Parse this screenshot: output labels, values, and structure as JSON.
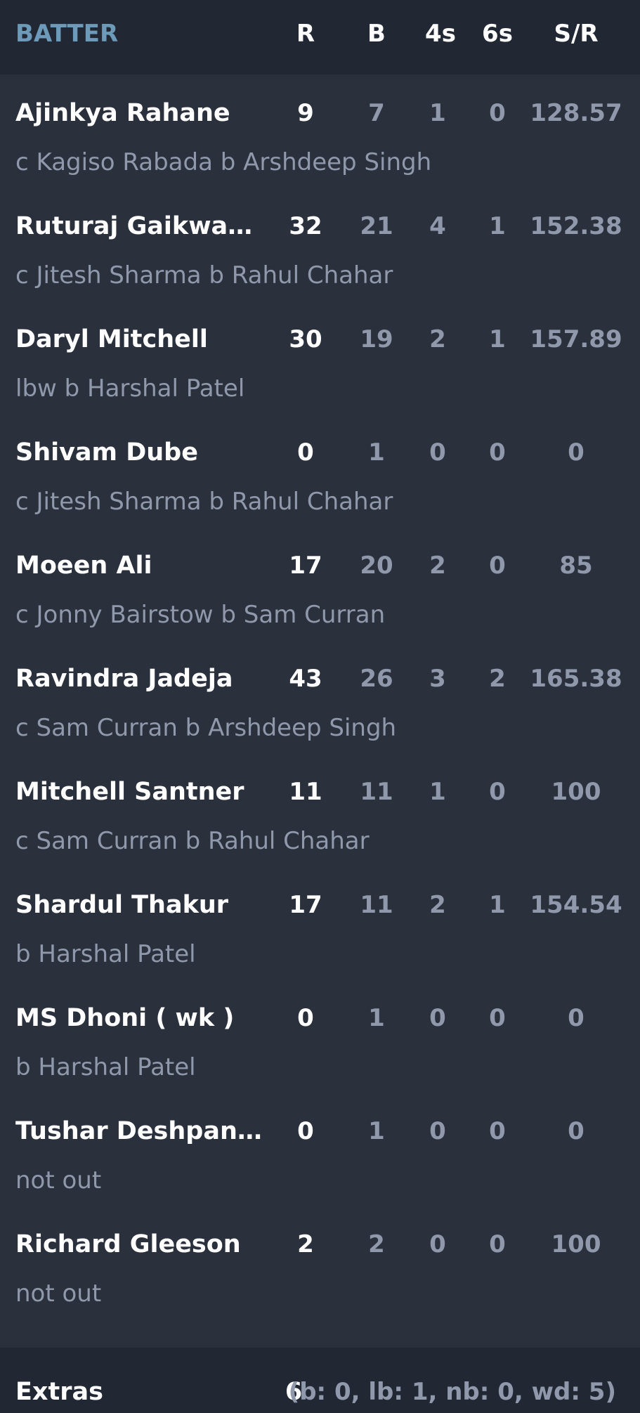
{
  "header": {
    "batter": "BATTER",
    "runs": "R",
    "balls": "B",
    "fours": "4s",
    "sixes": "6s",
    "strike_rate": "S/R"
  },
  "batters": [
    {
      "name": "Ajinkya Rahane",
      "dismissal": "c Kagiso Rabada b Arshdeep Singh",
      "runs": "9",
      "balls": "7",
      "fours": "1",
      "sixes": "0",
      "strike_rate": "128.57"
    },
    {
      "name": "Ruturaj Gaikwad (c)",
      "dismissal": "c Jitesh Sharma b Rahul Chahar",
      "runs": "32",
      "balls": "21",
      "fours": "4",
      "sixes": "1",
      "strike_rate": "152.38"
    },
    {
      "name": "Daryl Mitchell",
      "dismissal": "lbw b Harshal Patel",
      "runs": "30",
      "balls": "19",
      "fours": "2",
      "sixes": "1",
      "strike_rate": "157.89"
    },
    {
      "name": "Shivam Dube",
      "dismissal": "c Jitesh Sharma b Rahul Chahar",
      "runs": "0",
      "balls": "1",
      "fours": "0",
      "sixes": "0",
      "strike_rate": "0"
    },
    {
      "name": "Moeen Ali",
      "dismissal": "c Jonny Bairstow b Sam Curran",
      "runs": "17",
      "balls": "20",
      "fours": "2",
      "sixes": "0",
      "strike_rate": "85"
    },
    {
      "name": "Ravindra Jadeja",
      "dismissal": "c Sam Curran b Arshdeep Singh",
      "runs": "43",
      "balls": "26",
      "fours": "3",
      "sixes": "2",
      "strike_rate": "165.38"
    },
    {
      "name": "Mitchell Santner",
      "dismissal": "c Sam Curran b Rahul Chahar",
      "runs": "11",
      "balls": "11",
      "fours": "1",
      "sixes": "0",
      "strike_rate": "100"
    },
    {
      "name": "Shardul Thakur",
      "dismissal": "b Harshal Patel",
      "runs": "17",
      "balls": "11",
      "fours": "2",
      "sixes": "1",
      "strike_rate": "154.54"
    },
    {
      "name": "MS Dhoni ( wk )",
      "dismissal": "b Harshal Patel",
      "runs": "0",
      "balls": "1",
      "fours": "0",
      "sixes": "0",
      "strike_rate": "0"
    },
    {
      "name": "Tushar Deshpande",
      "dismissal": "not out",
      "runs": "0",
      "balls": "1",
      "fours": "0",
      "sixes": "0",
      "strike_rate": "0"
    },
    {
      "name": "Richard Gleeson",
      "dismissal": "not out",
      "runs": "2",
      "balls": "2",
      "fours": "0",
      "sixes": "0",
      "strike_rate": "100"
    }
  ],
  "extras": {
    "label": "Extras",
    "total": "6",
    "breakdown": "(b: 0, lb: 1, nb: 0, wd: 5)"
  },
  "colors": {
    "background": "#2a303c",
    "header_background": "#222833",
    "accent": "#6d9ab8",
    "primary_text": "#ffffff",
    "secondary_text": "#8f99ab"
  }
}
